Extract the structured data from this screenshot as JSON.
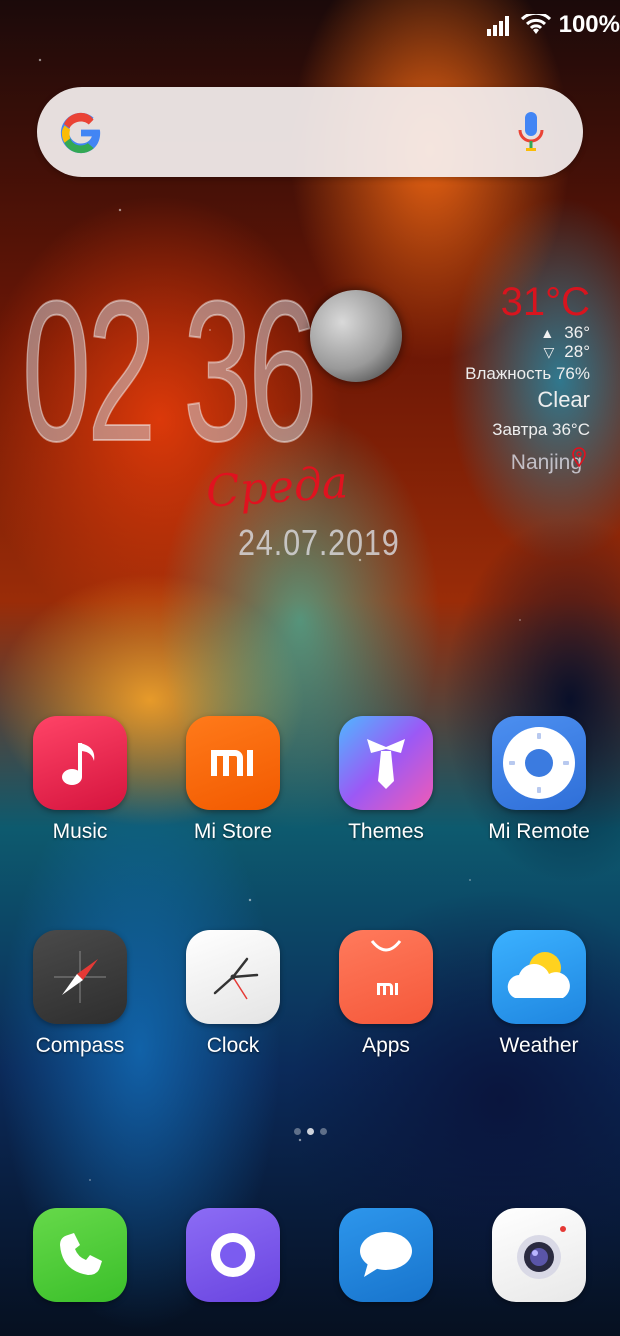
{
  "status_bar": {
    "battery_percent": "100%",
    "icons": [
      "signal-icon",
      "wifi-icon"
    ]
  },
  "search_bar": {
    "logo": "google-g-icon",
    "mic_icon": "mic-icon"
  },
  "clock_widget": {
    "time": "02 36",
    "weekday": "Среда",
    "date": "24.07.2019"
  },
  "weather_widget": {
    "temperature": "31°C",
    "high": "36°",
    "low": "28°",
    "humidity": "Влажность 76%",
    "condition": "Clear",
    "tomorrow": "Завтра 36°C",
    "city": "Nanjing"
  },
  "apps_row1": [
    {
      "label": "Music",
      "icon": "music-note-icon",
      "color": "#e8204f"
    },
    {
      "label": "Mi Store",
      "icon": "mi-logo-icon",
      "color": "#ff6a00"
    },
    {
      "label": "Themes",
      "icon": "tie-icon",
      "color": "#8f5cf0"
    },
    {
      "label": "Mi Remote",
      "icon": "remote-control-icon",
      "color": "#3b82f6"
    }
  ],
  "apps_row2": [
    {
      "label": "Compass",
      "icon": "compass-icon",
      "color": "#3d3d3d"
    },
    {
      "label": "Clock",
      "icon": "clock-icon",
      "color": "#f1f1f1"
    },
    {
      "label": "Apps",
      "icon": "shopping-bag-icon",
      "color": "#ff6a47"
    },
    {
      "label": "Weather",
      "icon": "sun-cloud-icon",
      "color": "#2e9cf2"
    }
  ],
  "dock": [
    {
      "icon": "phone-icon",
      "color": "#4cd137"
    },
    {
      "icon": "browser-icon",
      "color": "#7b5cf0"
    },
    {
      "icon": "messages-icon",
      "color": "#1f86e0"
    },
    {
      "icon": "camera-icon",
      "color": "#f5f5f5"
    }
  ],
  "page_indicator": {
    "pages": 3,
    "active": 1
  }
}
